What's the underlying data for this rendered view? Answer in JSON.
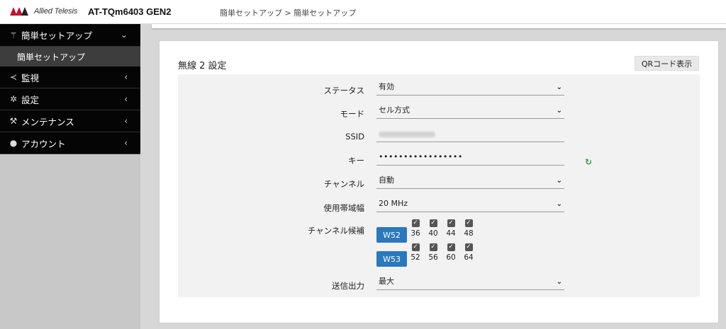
{
  "header": {
    "logo_text": "Allied Telesis",
    "model": "AT-TQm6403 GEN2",
    "breadcrumb": "簡単セットアップ > 簡単セットアップ"
  },
  "sidebar": {
    "items": [
      {
        "label": "簡単セットアップ",
        "icon": "magic-wand-icon"
      },
      {
        "label": "簡単セットアップ"
      },
      {
        "label": "監視",
        "icon": "share-icon"
      },
      {
        "label": "設定",
        "icon": "gear-icon"
      },
      {
        "label": "メンテナンス",
        "icon": "wrench-icon"
      },
      {
        "label": "アカウント",
        "icon": "user-icon"
      }
    ]
  },
  "panel": {
    "title": "無線 2 設定",
    "qr_button": "QRコード表示"
  },
  "form": {
    "status": {
      "label": "ステータス",
      "value": "有効"
    },
    "mode": {
      "label": "モード",
      "value": "セル方式"
    },
    "ssid": {
      "label": "SSID"
    },
    "key": {
      "label": "キー",
      "value": "•••••••••••••••••"
    },
    "channel": {
      "label": "チャンネル",
      "value": "自動"
    },
    "bandwidth": {
      "label": "使用帯域幅",
      "value": "20 MHz"
    },
    "channel_candidates": {
      "label": "チャンネル候補",
      "w52": {
        "label": "W52",
        "channels": [
          "36",
          "40",
          "44",
          "48"
        ]
      },
      "w53": {
        "label": "W53",
        "channels": [
          "52",
          "56",
          "60",
          "64"
        ]
      }
    },
    "tx_power": {
      "label": "送信出力",
      "value": "最大"
    }
  },
  "colors": {
    "accent": "#2a78be",
    "nav_bg": "#050505",
    "refresh": "#3a9a3a"
  }
}
